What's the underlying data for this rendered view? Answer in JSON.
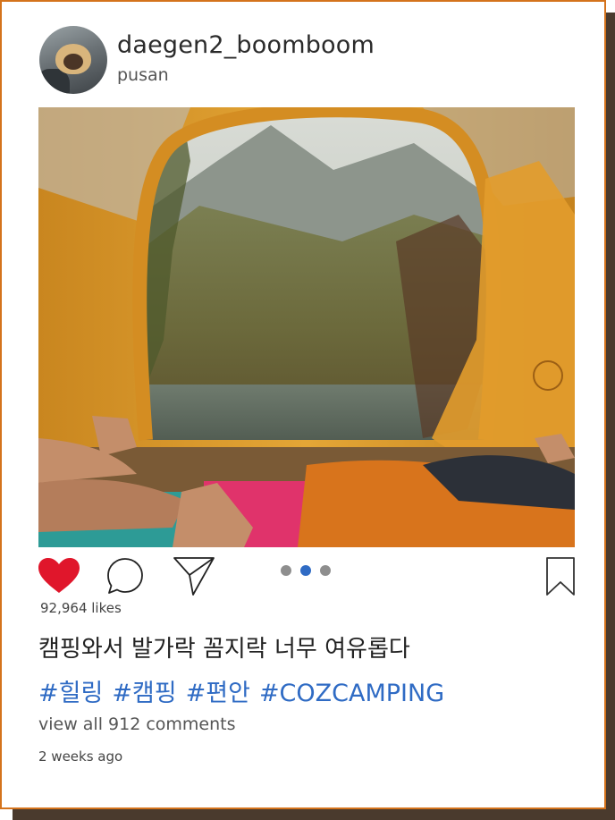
{
  "post": {
    "username": "daegen2_boomboom",
    "location": "pusan",
    "likes_text": "92,964 likes",
    "caption": "캠핑와서 발가락 꼼지락 너무 여유롭다",
    "hashtags": [
      "#힐링",
      "#캠핑",
      "#편안",
      "#COZCAMPING"
    ],
    "comments_link": "view all 912 comments",
    "posted_time": "2 weeks ago"
  },
  "carousel": {
    "count": 3,
    "active_index": 1
  },
  "icons": {
    "like": "heart-icon",
    "comment": "comment-icon",
    "share": "send-icon",
    "save": "bookmark-icon"
  },
  "colors": {
    "frame_border": "#d4731c",
    "heart_fill": "#e0162b",
    "hashtag": "#2f6bc4",
    "dot_active": "#2f6bc4",
    "dot_inactive": "#8e8e8e"
  }
}
